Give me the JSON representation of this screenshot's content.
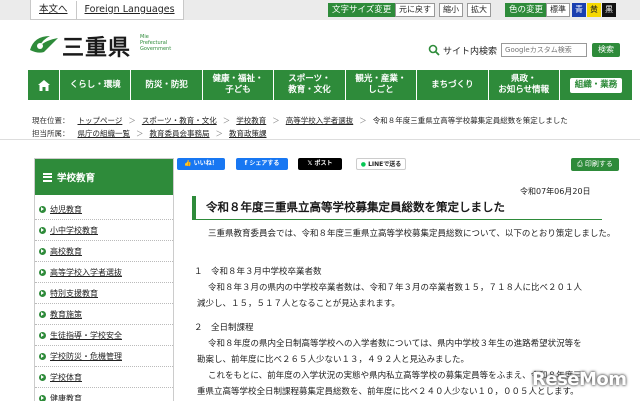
{
  "topbar": {
    "links": [
      "本文へ",
      "Foreign Languages"
    ],
    "text_size_label": "文字サイズ変更",
    "text_size_buttons": [
      "元に戻す",
      "縮小",
      "拡大"
    ],
    "color_label": "色の変更",
    "color_buttons": [
      "標準",
      "青",
      "黄",
      "黒"
    ]
  },
  "logo": {
    "name": "三重県",
    "sub": [
      "Mie",
      "Prefectural",
      "Government"
    ]
  },
  "search": {
    "label": "サイト内検索",
    "placeholder": "Googleカスタム検索",
    "button": "検索"
  },
  "nav": {
    "items": [
      "くらし・環境",
      "防災・防犯",
      "健康・福祉・\n子ども",
      "スポーツ・\n教育・文化",
      "観光・産業・\nしごと",
      "まちづくり",
      "県政・\nお知らせ情報"
    ],
    "last": "組織・業務"
  },
  "breadcrumb": {
    "label1": "現在位置：",
    "path": [
      "トップページ",
      "スポーツ・教育・文化",
      "学校教育",
      "高等学校入学者選抜"
    ],
    "current": "令和８年度三重県立高等学校募集定員総数を策定しました",
    "label2": "担当所属：",
    "dept": [
      "県庁の組織一覧",
      "教育委員会事務局",
      "教育政策課"
    ]
  },
  "sidebar": {
    "title": "学校教育",
    "items": [
      "幼児教育",
      "小中学校教育",
      "高校教育",
      "高等学校入学者選抜",
      "特別支援教育",
      "教育施策",
      "生徒指導・学校安全",
      "学校防災・危機管理",
      "学校体育",
      "健康教育"
    ]
  },
  "share": {
    "facebook_like": "いいね！",
    "facebook_share": "シェアする",
    "x_post": "ポスト",
    "line": "LINEで送る",
    "print": "印刷する"
  },
  "article": {
    "date": "令和07年06月20日",
    "title": "令和８年度三重県立高等学校募集定員総数を策定しました",
    "intro": "三重県教育委員会では、令和８年度三重県立高等学校募集定員総数について、以下のとおり策定しました。",
    "s1_heading": "１　令和８年３月中学校卒業者数",
    "s1_line1": "令和８年３月の県内の中学校卒業者数は、令和７年３月の卒業者数１５，７１８人に比べ２０１人",
    "s1_line2": "減少し、１５，５１７人となることが見込まれます。",
    "s2_heading": "２　全日制課程",
    "s2_line1": "令和８年度の県内全日制高等学校への入学者数については、県内中学校３年生の進路希望状況等を",
    "s2_line2": "勘案し、前年度に比べ２６５人少ない１３，４９２人と見込みました。",
    "s2_line3": "これをもとに、前年度の入学状況の実態や県内私立高等学校の募集定員等をふまえ、令和８年度三",
    "s2_line4": "重県立高等学校全日制課程募集定員総数を、前年度に比べ２４０人少ない１０，００５人とします。"
  },
  "watermark": "ReseMom",
  "colors": {
    "brand_green": "#2e8b3a",
    "facebook_blue": "#1877f2",
    "line_green": "#06c755"
  }
}
